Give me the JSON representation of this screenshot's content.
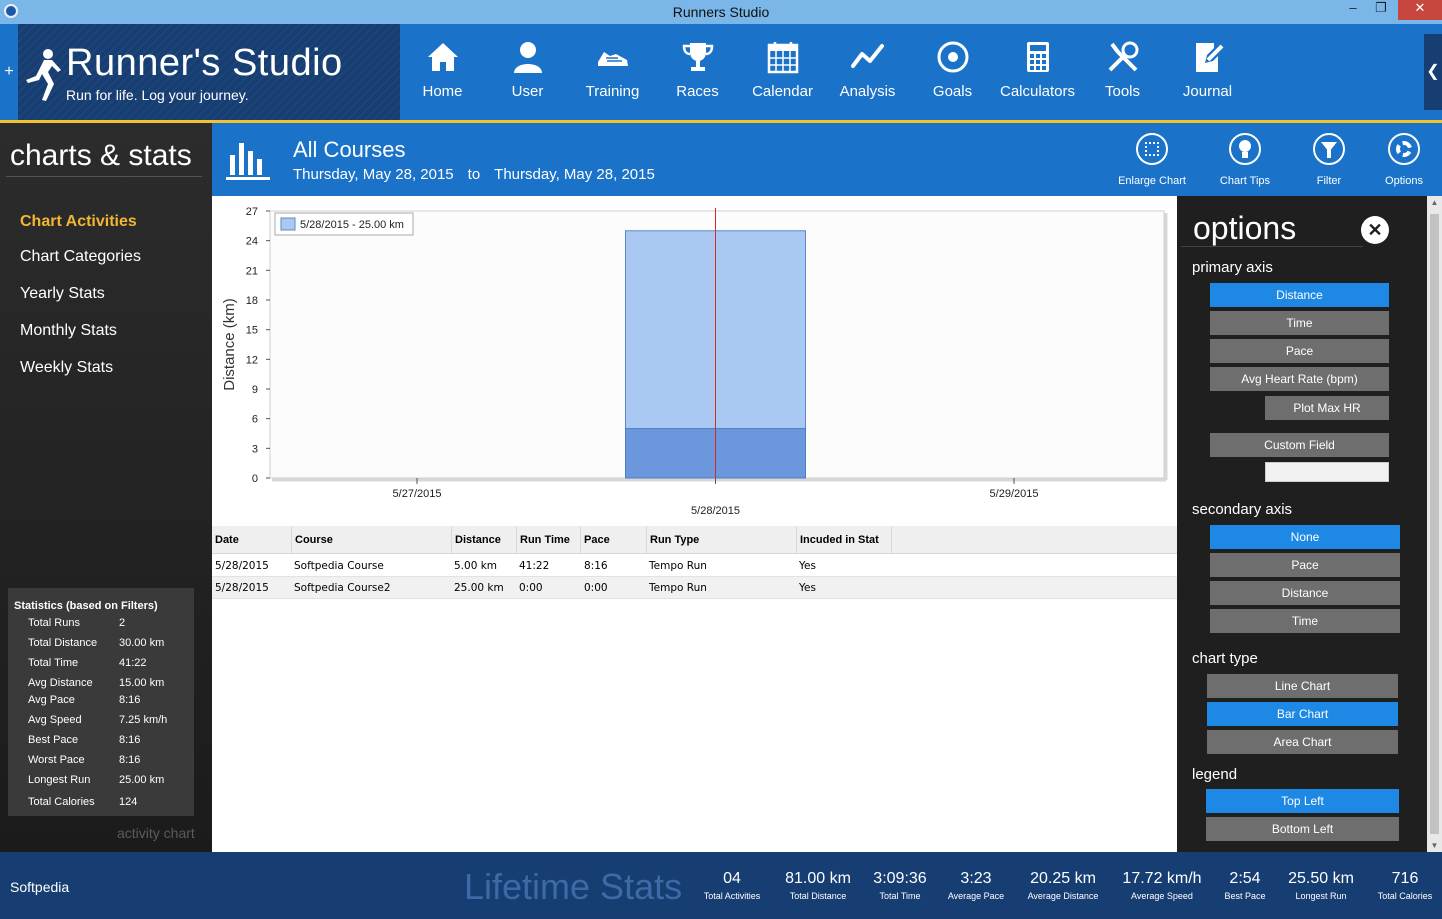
{
  "window": {
    "title": "Runners Studio"
  },
  "app": {
    "name": "Runner's Studio",
    "tagline": "Run for life. Log your journey."
  },
  "nav": [
    {
      "label": "Home",
      "icon": "home-icon"
    },
    {
      "label": "User",
      "icon": "user-icon"
    },
    {
      "label": "Training",
      "icon": "shoe-icon"
    },
    {
      "label": "Races",
      "icon": "trophy-icon"
    },
    {
      "label": "Calendar",
      "icon": "calendar-icon"
    },
    {
      "label": "Analysis",
      "icon": "trend-icon"
    },
    {
      "label": "Goals",
      "icon": "target-icon"
    },
    {
      "label": "Calculators",
      "icon": "calculator-icon"
    },
    {
      "label": "Tools",
      "icon": "tools-icon"
    },
    {
      "label": "Journal",
      "icon": "journal-icon"
    }
  ],
  "sidebar": {
    "title": "charts & stats",
    "items": [
      {
        "label": "Chart Activities",
        "active": true
      },
      {
        "label": "Chart Categories"
      },
      {
        "label": "Yearly Stats"
      },
      {
        "label": "Monthly Stats"
      },
      {
        "label": "Weekly Stats"
      }
    ],
    "stats_title": "Statistics (based on Filters)",
    "stats": [
      {
        "k": "Total Runs",
        "v": "2"
      },
      {
        "k": "Total Distance",
        "v": "30.00 km"
      },
      {
        "k": "Total Time",
        "v": "41:22"
      },
      {
        "k": "Avg Distance",
        "v": "15.00 km"
      },
      {
        "k": "Avg Pace",
        "v": "8:16"
      },
      {
        "k": "Avg Speed",
        "v": "7.25 km/h"
      },
      {
        "k": "Best Pace",
        "v": "8:16"
      },
      {
        "k": "Worst Pace",
        "v": "8:16"
      },
      {
        "k": "Longest Run",
        "v": "25.00 km"
      },
      {
        "k": "Total Calories",
        "v": "124"
      }
    ],
    "caption": "activity chart"
  },
  "band": {
    "title": "All Courses",
    "date_from": "Thursday, May 28, 2015",
    "date_to_word": "to",
    "date_to": "Thursday, May 28, 2015",
    "buttons": [
      "Enlarge Chart",
      "Chart Tips",
      "Filter",
      "Options"
    ]
  },
  "chart_data": {
    "type": "bar",
    "ylabel": "Distance (km)",
    "ylim": [
      0,
      27
    ],
    "yticks": [
      "0",
      "3",
      "6",
      "9",
      "12",
      "15",
      "18",
      "21",
      "24",
      "27"
    ],
    "xticks": [
      "5/27/2015",
      "5/28/2015",
      "5/29/2015"
    ],
    "legend": "5/28/2015 - 25.00 km",
    "legend_position": "top-left",
    "bars": [
      {
        "x": "5/28/2015",
        "segments": [
          5.0,
          25.0
        ]
      }
    ]
  },
  "table": {
    "headers": [
      "Date",
      "Course",
      "Distance",
      "Run Time",
      "Pace",
      "Run Type",
      "Incuded in Stat"
    ],
    "rows": [
      [
        "5/28/2015",
        "Softpedia Course",
        "5.00 km",
        "41:22",
        "8:16",
        "Tempo Run",
        "Yes"
      ],
      [
        "5/28/2015",
        "Softpedia Course2",
        "25.00 km",
        "0:00",
        "0:00",
        "Tempo Run",
        "Yes"
      ]
    ]
  },
  "options": {
    "title": "options",
    "primary_axis": {
      "heading": "primary axis",
      "items": [
        "Distance",
        "Time",
        "Pace",
        "Avg Heart Rate (bpm)"
      ],
      "selected": "Distance",
      "extra": "Plot Max HR",
      "custom": "Custom Field"
    },
    "secondary_axis": {
      "heading": "secondary axis",
      "items": [
        "None",
        "Pace",
        "Distance",
        "Time"
      ],
      "selected": "None"
    },
    "chart_type": {
      "heading": "chart type",
      "items": [
        "Line Chart",
        "Bar Chart",
        "Area Chart"
      ],
      "selected": "Bar Chart"
    },
    "legend": {
      "heading": "legend",
      "items": [
        "Top Left",
        "Bottom Left"
      ],
      "selected": "Top Left"
    }
  },
  "footer": {
    "brand": "Softpedia",
    "title": "Lifetime Stats",
    "stats": [
      {
        "v": "04",
        "l": "Total Activities"
      },
      {
        "v": "81.00 km",
        "l": "Total Distance"
      },
      {
        "v": "3:09:36",
        "l": "Total Time"
      },
      {
        "v": "3:23",
        "l": "Average Pace"
      },
      {
        "v": "20.25 km",
        "l": "Average Distance"
      },
      {
        "v": "17.72 km/h",
        "l": "Average Speed"
      },
      {
        "v": "2:54",
        "l": "Best Pace"
      },
      {
        "v": "25.50 km",
        "l": "Longest Run"
      },
      {
        "v": "716",
        "l": "Total Calories"
      }
    ]
  }
}
